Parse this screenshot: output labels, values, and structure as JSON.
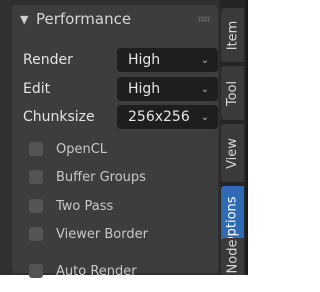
{
  "panel": {
    "title": "Performance",
    "fields": [
      {
        "label": "Render",
        "value": "High"
      },
      {
        "label": "Edit",
        "value": "High"
      },
      {
        "label": "Chunksize",
        "value": "256x256"
      }
    ],
    "checkboxes": [
      {
        "label": "OpenCL",
        "checked": false
      },
      {
        "label": "Buffer Groups",
        "checked": false
      },
      {
        "label": "Two Pass",
        "checked": false
      },
      {
        "label": "Viewer Border",
        "checked": false
      },
      {
        "label": "Auto Render",
        "checked": false
      }
    ]
  },
  "tabs": [
    {
      "label": "Item",
      "active": false
    },
    {
      "label": "Tool",
      "active": false
    },
    {
      "label": "View",
      "active": false
    },
    {
      "label": "Options",
      "active": true
    },
    {
      "label": "Node",
      "active": false
    }
  ],
  "colors": {
    "panel_bg": "#3d3d3d",
    "field_bg": "#1e1e1e",
    "active_tab": "#2f6bb2"
  },
  "icons": {
    "collapse": "chevron-down-icon",
    "grip": "drag-handle-icon",
    "dropdown": "chevron-down-icon"
  }
}
